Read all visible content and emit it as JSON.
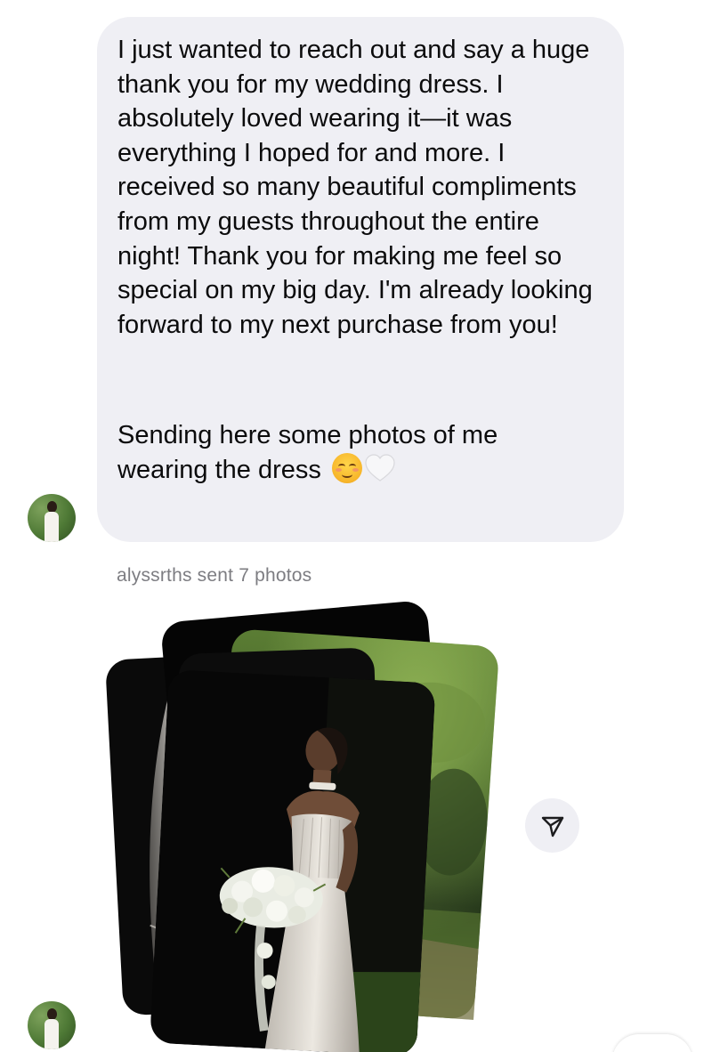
{
  "message": {
    "paragraph_1": "I just wanted to reach out and say a huge thank you for my wedding dress. I absolutely loved wearing it—it was everything I hoped for and more. I received so many beautiful compliments from my guests throughout the entire night! Thank you for making me feel so special on my big day. I'm already looking forward to my next purchase from you!",
    "paragraph_2_line_1": "Sending here some photos of me",
    "paragraph_2_line_2": "wearing the dress",
    "emojis": [
      "smiling-face-with-blush-emoji",
      "white-heart-emoji"
    ]
  },
  "photos": {
    "caption": "alyssrths sent 7 photos",
    "count": 7
  },
  "icons": {
    "share": "send-share-icon",
    "avatar": "profile-avatar"
  },
  "colors": {
    "bubble_background": "#efeff4",
    "message_text": "#0b0b0c",
    "caption_text": "#7d7d82",
    "share_button_background": "#efeff4"
  }
}
